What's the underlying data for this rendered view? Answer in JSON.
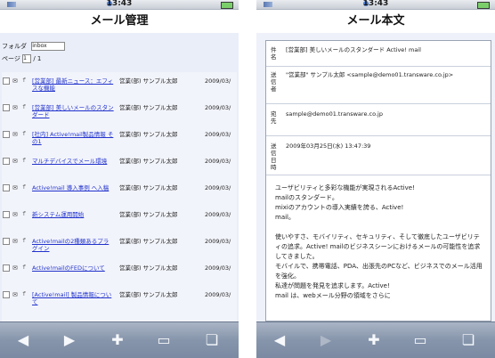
{
  "status": {
    "time": "13:43"
  },
  "left": {
    "title": "メール管理",
    "folder_label": "フォルダ",
    "folder_value": "inbox",
    "page_label": "ページ",
    "page_value": "1",
    "page_total": "/ 1",
    "rows": [
      {
        "subject": "[営業部] 最新ニュース：エフィスな機能",
        "from": "営業(部) サンプル太郎",
        "date": "2009/03/"
      },
      {
        "subject": "[営業部] 美しいメールのスタンダード",
        "from": "営業(部) サンプル太郎",
        "date": "2009/03/"
      },
      {
        "subject": "[社内] Active!mail製品情報 その1",
        "from": "営業(部) サンプル太郎",
        "date": "2009/03/"
      },
      {
        "subject": "マルチデバイスでメール環境",
        "from": "営業(部) サンプル太郎",
        "date": "2009/03/"
      },
      {
        "subject": "Active!mail 導入事例 へ入稿",
        "from": "営業(部) サンプル太郎",
        "date": "2009/03/"
      },
      {
        "subject": "新システム運用開始",
        "from": "営業(部) サンプル太郎",
        "date": "2009/03/"
      },
      {
        "subject": "Active!mailの2種類あるプラグイン",
        "from": "営業(部) サンプル太郎",
        "date": "2009/03/"
      },
      {
        "subject": "Active!mailのFEDについて",
        "from": "営業(部) サンプル太郎",
        "date": "2009/03/"
      },
      {
        "subject": "[Active!mail] 製品情報について",
        "from": "営業(部) サンプル太郎",
        "date": "2009/03/"
      }
    ]
  },
  "right": {
    "title": "メール本文",
    "headers": [
      {
        "key": "件名",
        "value": "[営業部] 美しいメールのスタンダード Active! mail"
      },
      {
        "key": "送信者",
        "value": "\"営業部\" サンプル太郎 <sample@demo01.transware.co.jp>"
      },
      {
        "key": "宛先",
        "value": "sample@demo01.transware.co.jp"
      },
      {
        "key": "送信日時",
        "value": "2009年03月25日(水) 13:47:39"
      }
    ],
    "body": "ユーザビリティと多彩な機能が実現されるActive!\nmailのスタンダード。\nmixiのアカウントの導入実績を誇る、Active!\nmail。\n\n使いやすさ、モバイリティ、セキュリティ、そして徹底したユーザビリティの追求。Active! mailのビジネスシーンにおけるメールの可能性を追求してきました。\nモバイルで、携帯電話、PDA、出張先のPCなど、ビジネスでのメール活用を強化。\n私達が問題を発見を追求します。Active!\nmail は、webメール分野の領域をさらに"
  },
  "toolbar_icons": [
    "back-icon",
    "forward-icon",
    "add-icon",
    "bookmarks-icon",
    "pages-icon"
  ]
}
